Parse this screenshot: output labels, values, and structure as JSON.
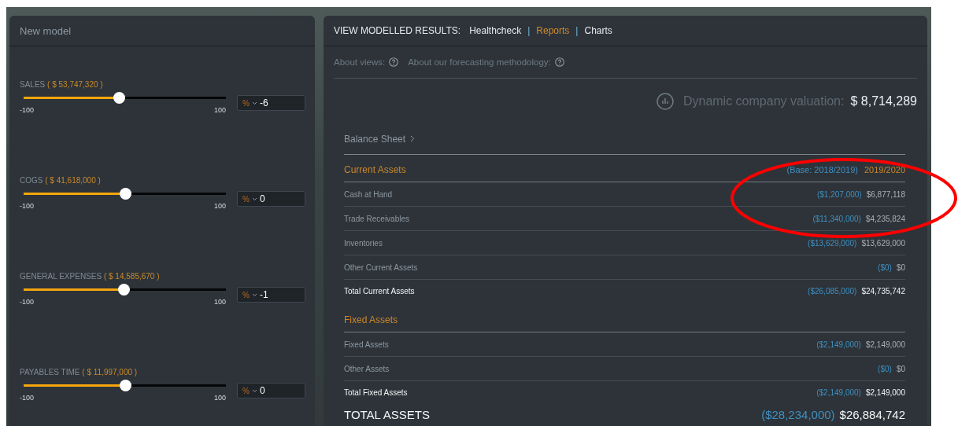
{
  "model_panel": {
    "title": "New model",
    "drivers": [
      {
        "label": "SALES",
        "amount": "( $ 53,747,320 )",
        "level": 0.47,
        "min": "-100",
        "max": "100",
        "unit": "%",
        "value": "-6"
      },
      {
        "label": "COGS",
        "amount": "( $ 41,618,000 )",
        "level": 0.5,
        "min": "-100",
        "max": "100",
        "unit": "%",
        "value": "0"
      },
      {
        "label": "GENERAL EXPENSES",
        "amount": "( $ 14,585,670 )",
        "level": 0.495,
        "min": "-100",
        "max": "100",
        "unit": "%",
        "value": "-1"
      },
      {
        "label": "PAYABLES TIME",
        "amount": "( $ 11,997,000 )",
        "level": 0.5,
        "min": "-100",
        "max": "100",
        "unit": "%",
        "value": "0"
      }
    ]
  },
  "results_panel": {
    "heading": "VIEW MODELLED RESULTS:",
    "separator": "|",
    "views": [
      {
        "label": "Healthcheck",
        "selected": false
      },
      {
        "label": "Reports",
        "selected": true
      },
      {
        "label": "Charts",
        "selected": false
      }
    ],
    "help_links": [
      "About views:",
      "About our forecasting methodology:"
    ],
    "valuation": {
      "label": "Dynamic company valuation:",
      "value": "$ 8,714,289"
    },
    "report_title": "Balance Sheet",
    "sections": [
      {
        "title": "Current Assets",
        "base_header": "(Base: 2018/2019)",
        "year_header": "2019/2020",
        "rows": [
          {
            "label": "Cash at Hand",
            "base": "($1,207,000)",
            "value": "$6,877,118",
            "total": false
          },
          {
            "label": "Trade Receivables",
            "base": "($11,340,000)",
            "value": "$4,235,824",
            "total": false
          },
          {
            "label": "Inventories",
            "base": "($13,629,000)",
            "value": "$13,629,000",
            "total": false
          },
          {
            "label": "Other Current Assets",
            "base": "($0)",
            "value": "$0",
            "total": false
          },
          {
            "label": "Total Current Assets",
            "base": "($26,085,000)",
            "value": "$24,735,742",
            "total": true
          }
        ]
      },
      {
        "title": "Fixed Assets",
        "rows": [
          {
            "label": "Fixed Assets",
            "base": "($2,149,000)",
            "value": "$2,149,000",
            "total": false
          },
          {
            "label": "Other Assets",
            "base": "($0)",
            "value": "$0",
            "total": false
          },
          {
            "label": "Total Fixed Assets",
            "base": "($2,149,000)",
            "value": "$2,149,000",
            "total": true
          }
        ]
      }
    ],
    "grand_total": {
      "label": "TOTAL ASSETS",
      "base": "($28,234,000)",
      "value": "$26,884,742"
    }
  },
  "annotation": {
    "kind": "ellipse"
  }
}
